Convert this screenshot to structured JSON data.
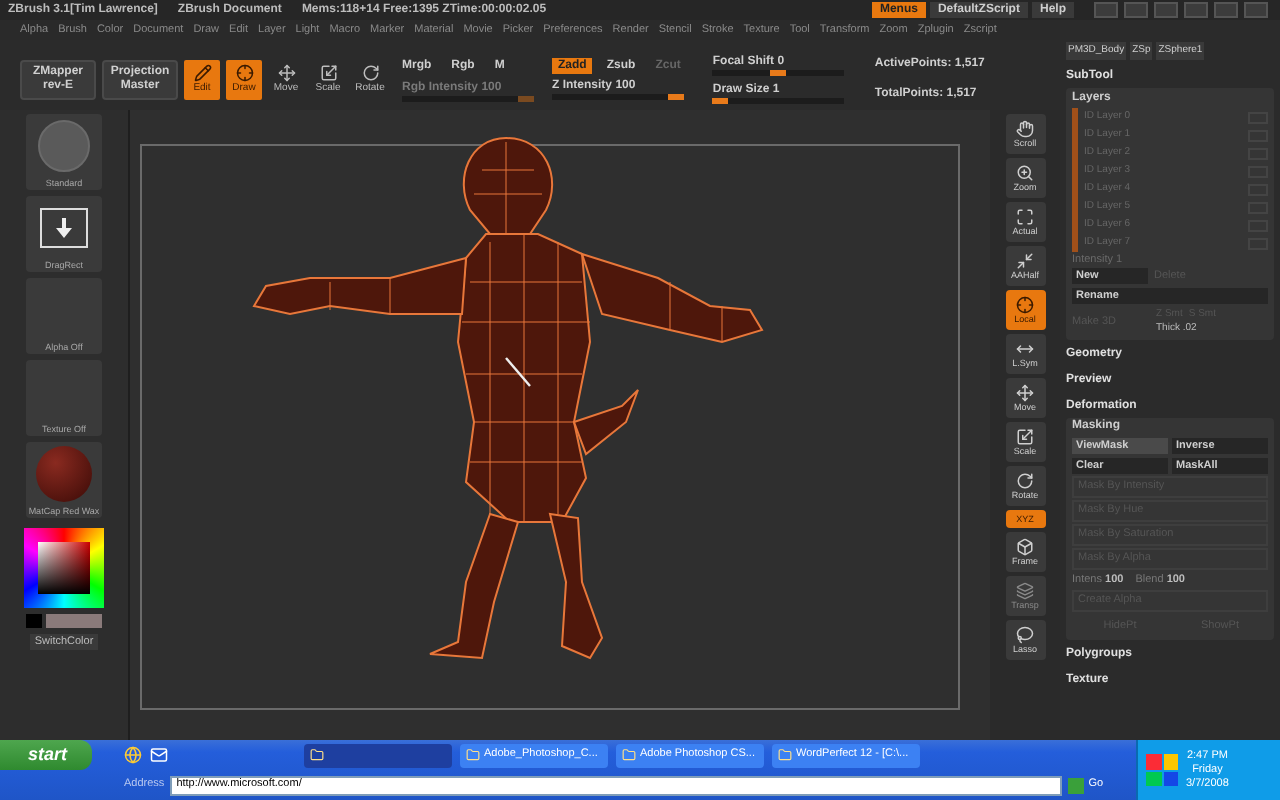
{
  "title_bar": {
    "app": "ZBrush 3.1[Tim Lawrence]",
    "document": "ZBrush Document",
    "stats": "Mems:118+14 Free:1395 ZTime:00:00:02.05",
    "buttons": [
      {
        "label": "Menus",
        "selected": true
      },
      {
        "label": "DefaultZScript",
        "selected": false
      },
      {
        "label": "Help",
        "selected": false
      }
    ]
  },
  "menu_bar": [
    "Alpha",
    "Brush",
    "Color",
    "Document",
    "Draw",
    "Edit",
    "Layer",
    "Light",
    "Macro",
    "Marker",
    "Material",
    "Movie",
    "Picker",
    "Preferences",
    "Render",
    "Stencil",
    "Stroke",
    "Texture",
    "Tool",
    "Transform",
    "Zoom",
    "Zplugin",
    "Zscript"
  ],
  "toolbar": {
    "plugins": [
      {
        "line1": "ZMapper",
        "line2": "rev-E"
      },
      {
        "line1": "Projection",
        "line2": "Master"
      }
    ],
    "modes": [
      {
        "label": "Edit",
        "selected": true
      },
      {
        "label": "Draw",
        "selected": true
      },
      {
        "label": "Move",
        "selected": false
      },
      {
        "label": "Scale",
        "selected": false
      },
      {
        "label": "Rotate",
        "selected": false
      }
    ],
    "color_modes": [
      {
        "label": "Mrgb",
        "disabled": false
      },
      {
        "label": "Rgb",
        "disabled": false
      },
      {
        "label": "M",
        "disabled": false
      }
    ],
    "rgb_intensity": {
      "label": "Rgb Intensity",
      "value": "100",
      "disabled": true,
      "level": 1
    },
    "z_modes": [
      {
        "label": "Zadd",
        "selected": true,
        "disabled": false
      },
      {
        "label": "Zsub",
        "selected": false,
        "disabled": false
      },
      {
        "label": "Zcut",
        "selected": false,
        "disabled": true
      }
    ],
    "z_intensity": {
      "label": "Z Intensity",
      "value": "100",
      "level": 1
    },
    "focal_shift": {
      "label": "Focal Shift",
      "value": "0",
      "level": 0.5
    },
    "draw_size": {
      "label": "Draw Size",
      "value": "1",
      "level": 0
    },
    "active_points": "ActivePoints: 1,517",
    "total_points": "TotalPoints: 1,517"
  },
  "left_shelf": [
    {
      "label": "Standard",
      "kind": "brush"
    },
    {
      "label": "DragRect",
      "kind": "stroke"
    },
    {
      "label": "Alpha Off",
      "kind": "empty"
    },
    {
      "label": "Texture Off",
      "kind": "empty"
    },
    {
      "label": "MatCap Red Wax",
      "kind": "material"
    }
  ],
  "switch_color": "SwitchColor",
  "right_shelf": [
    {
      "label": "Scroll",
      "selected": false,
      "disabled": false
    },
    {
      "label": "Zoom",
      "selected": false,
      "disabled": false
    },
    {
      "label": "Actual",
      "selected": false,
      "disabled": false
    },
    {
      "label": "AAHalf",
      "selected": false,
      "disabled": false
    },
    {
      "label": "Local",
      "selected": true,
      "disabled": false
    },
    {
      "label": "L.Sym",
      "selected": false,
      "disabled": false
    },
    {
      "label": "Move",
      "selected": false,
      "disabled": false
    },
    {
      "label": "Scale",
      "selected": false,
      "disabled": false
    },
    {
      "label": "Rotate",
      "selected": false,
      "disabled": false
    },
    {
      "label": "XYZ",
      "selected": true,
      "disabled": false
    },
    {
      "label": "Frame",
      "selected": false,
      "disabled": false
    },
    {
      "label": "Transp",
      "selected": false,
      "disabled": true
    },
    {
      "label": "Lasso",
      "selected": false,
      "disabled": false
    }
  ],
  "tool_panel": {
    "tools": [
      "PM3D_Body",
      "ZSp",
      "ZSphere1"
    ],
    "subtool": "SubTool",
    "layers_title": "Layers",
    "layers": [
      {
        "label": "ID Layer 0",
        "on": false
      },
      {
        "label": "ID Layer 1",
        "on": false
      },
      {
        "label": "ID Layer 2",
        "on": false
      },
      {
        "label": "ID Layer 3",
        "on": false
      },
      {
        "label": "ID Layer 4",
        "on": false
      },
      {
        "label": "ID Layer 5",
        "on": false
      },
      {
        "label": "ID Layer 6",
        "on": false
      },
      {
        "label": "ID Layer 7",
        "on": false
      }
    ],
    "intensity": {
      "label": "Intensity",
      "value": "1"
    },
    "new": "New",
    "delete": "Delete",
    "rename": "Rename",
    "make_3d": "Make 3D",
    "z_smt": "Z Smt",
    "s_smt": "S Smt",
    "thick": {
      "label": "Thick",
      "value": ".02"
    },
    "sections_before": [
      "Geometry",
      "Preview",
      "Deformation"
    ],
    "masking": {
      "title": "Masking",
      "buttons": [
        {
          "label": "ViewMask",
          "selected": true,
          "disabled": false
        },
        {
          "label": "Inverse",
          "selected": false,
          "disabled": false
        },
        {
          "label": "Clear",
          "selected": false,
          "disabled": false
        },
        {
          "label": "MaskAll",
          "selected": false,
          "disabled": false
        }
      ],
      "wide_buttons": [
        "Mask By Intensity",
        "Mask By Hue",
        "Mask By Saturation",
        "Mask By Alpha"
      ],
      "intens": {
        "label": "Intens",
        "value": "100"
      },
      "blend": {
        "label": "Blend",
        "value": "100"
      },
      "create_alpha": "Create Alpha",
      "hide_pt": "HidePt",
      "show_pt": "ShowPt"
    },
    "sections_after": [
      "Polygroups",
      "Texture"
    ]
  },
  "taskbar": {
    "start": "start",
    "tasks": [
      {
        "selected": true
      },
      {
        "label": "Adobe_Photoshop_C...",
        "selected": false
      },
      {
        "label": "Adobe Photoshop CS...",
        "selected": false
      },
      {
        "label": "WordPerfect 12 - [C:\\...",
        "selected": false
      }
    ],
    "address_label": "Address",
    "address": "http://www.microsoft.com/",
    "go": "Go",
    "time": "2:47 PM",
    "day": "Friday",
    "date": "3/7/2008"
  }
}
